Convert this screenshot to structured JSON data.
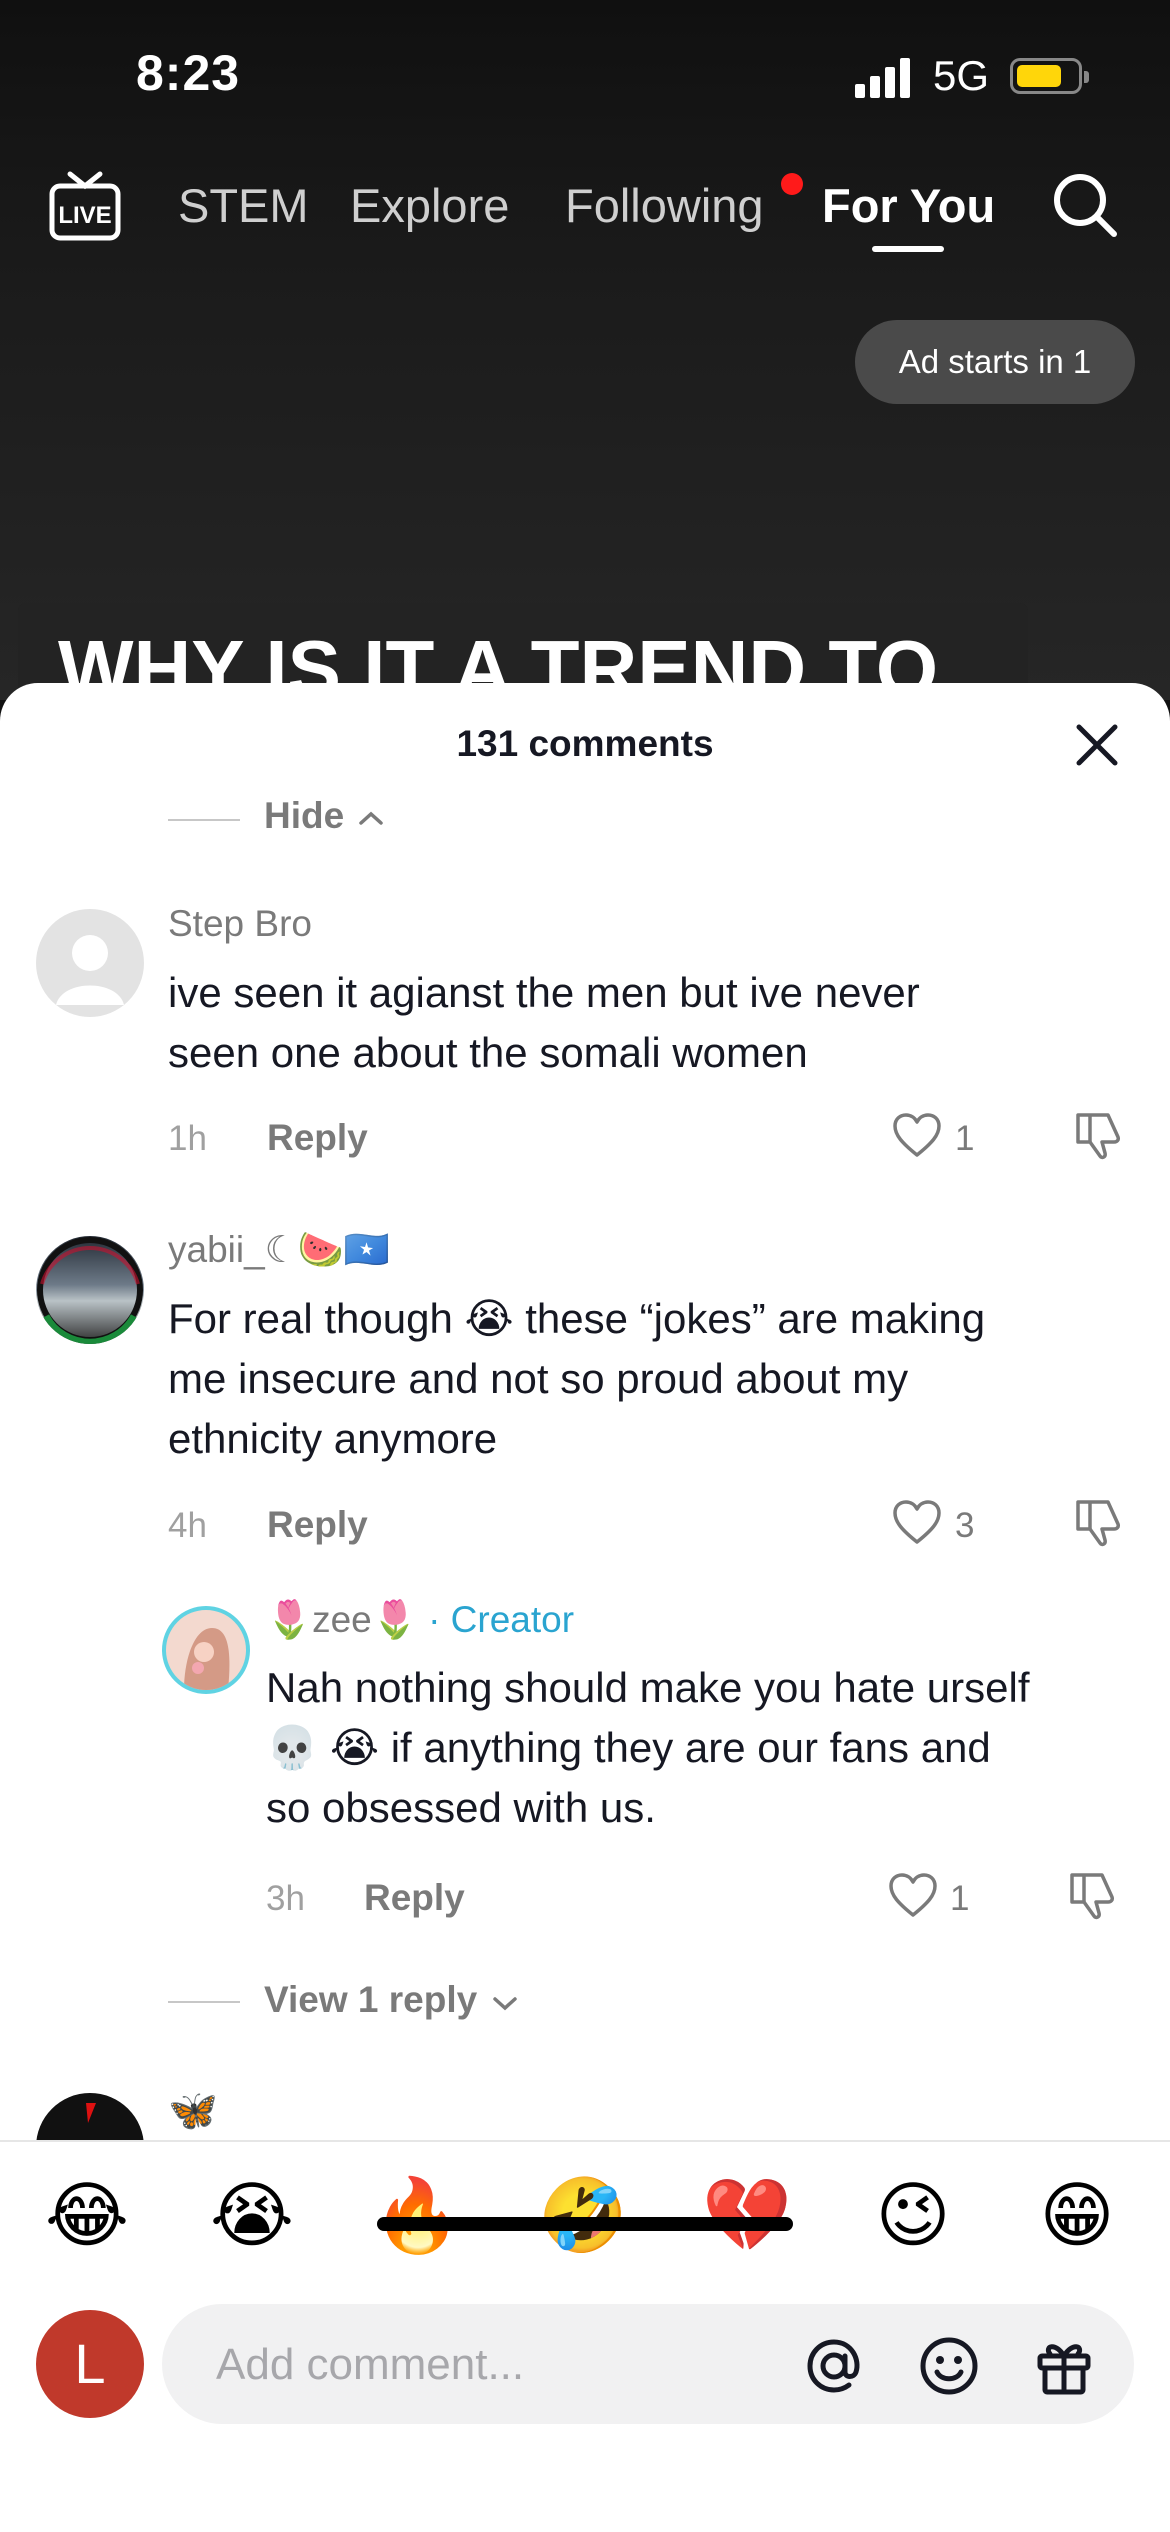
{
  "status": {
    "time": "8:23",
    "network": "5G"
  },
  "nav": {
    "live_label": "LIVE",
    "tabs": [
      {
        "label": "STEM",
        "active": false
      },
      {
        "label": "Explore",
        "active": false
      },
      {
        "label": "Following",
        "active": false,
        "notification": true
      },
      {
        "label": "For You",
        "active": true
      }
    ]
  },
  "video": {
    "ad_pill": "Ad starts in 1",
    "caption": "WHY IS IT A TREND TO"
  },
  "comments_sheet": {
    "title": "131 comments",
    "hide_label": "Hide",
    "comments": [
      {
        "username": "Step Bro",
        "text_line1": "ive seen it agianst the men but ive never",
        "text_line2": "seen one about the somali women",
        "time": "1h",
        "reply_label": "Reply",
        "likes": "1"
      },
      {
        "username": "yabii_☾🍉🇸🇴",
        "text_line1": "For real though 😭 these “jokes” are making",
        "text_line2": "me insecure and not so proud about my",
        "text_line3": "ethnicity anymore",
        "time": "4h",
        "reply_label": "Reply",
        "likes": "3",
        "replies": [
          {
            "username": "🌷zee🌷",
            "creator_label": "· Creator",
            "text_line1": "Nah nothing should make you hate urself",
            "text_line2": "💀 😭 if anything they are our fans and",
            "text_line3": "so obsessed with us.",
            "time": "3h",
            "reply_label": "Reply",
            "likes": "1"
          }
        ],
        "view_replies_label": "View 1 reply"
      },
      {
        "username": "🦋"
      }
    ]
  },
  "emoji_bar": [
    "😂",
    "😭",
    "🔥",
    "🤣",
    "💔",
    "😉",
    "😁"
  ],
  "composer": {
    "avatar_letter": "L",
    "placeholder": "Add comment..."
  }
}
